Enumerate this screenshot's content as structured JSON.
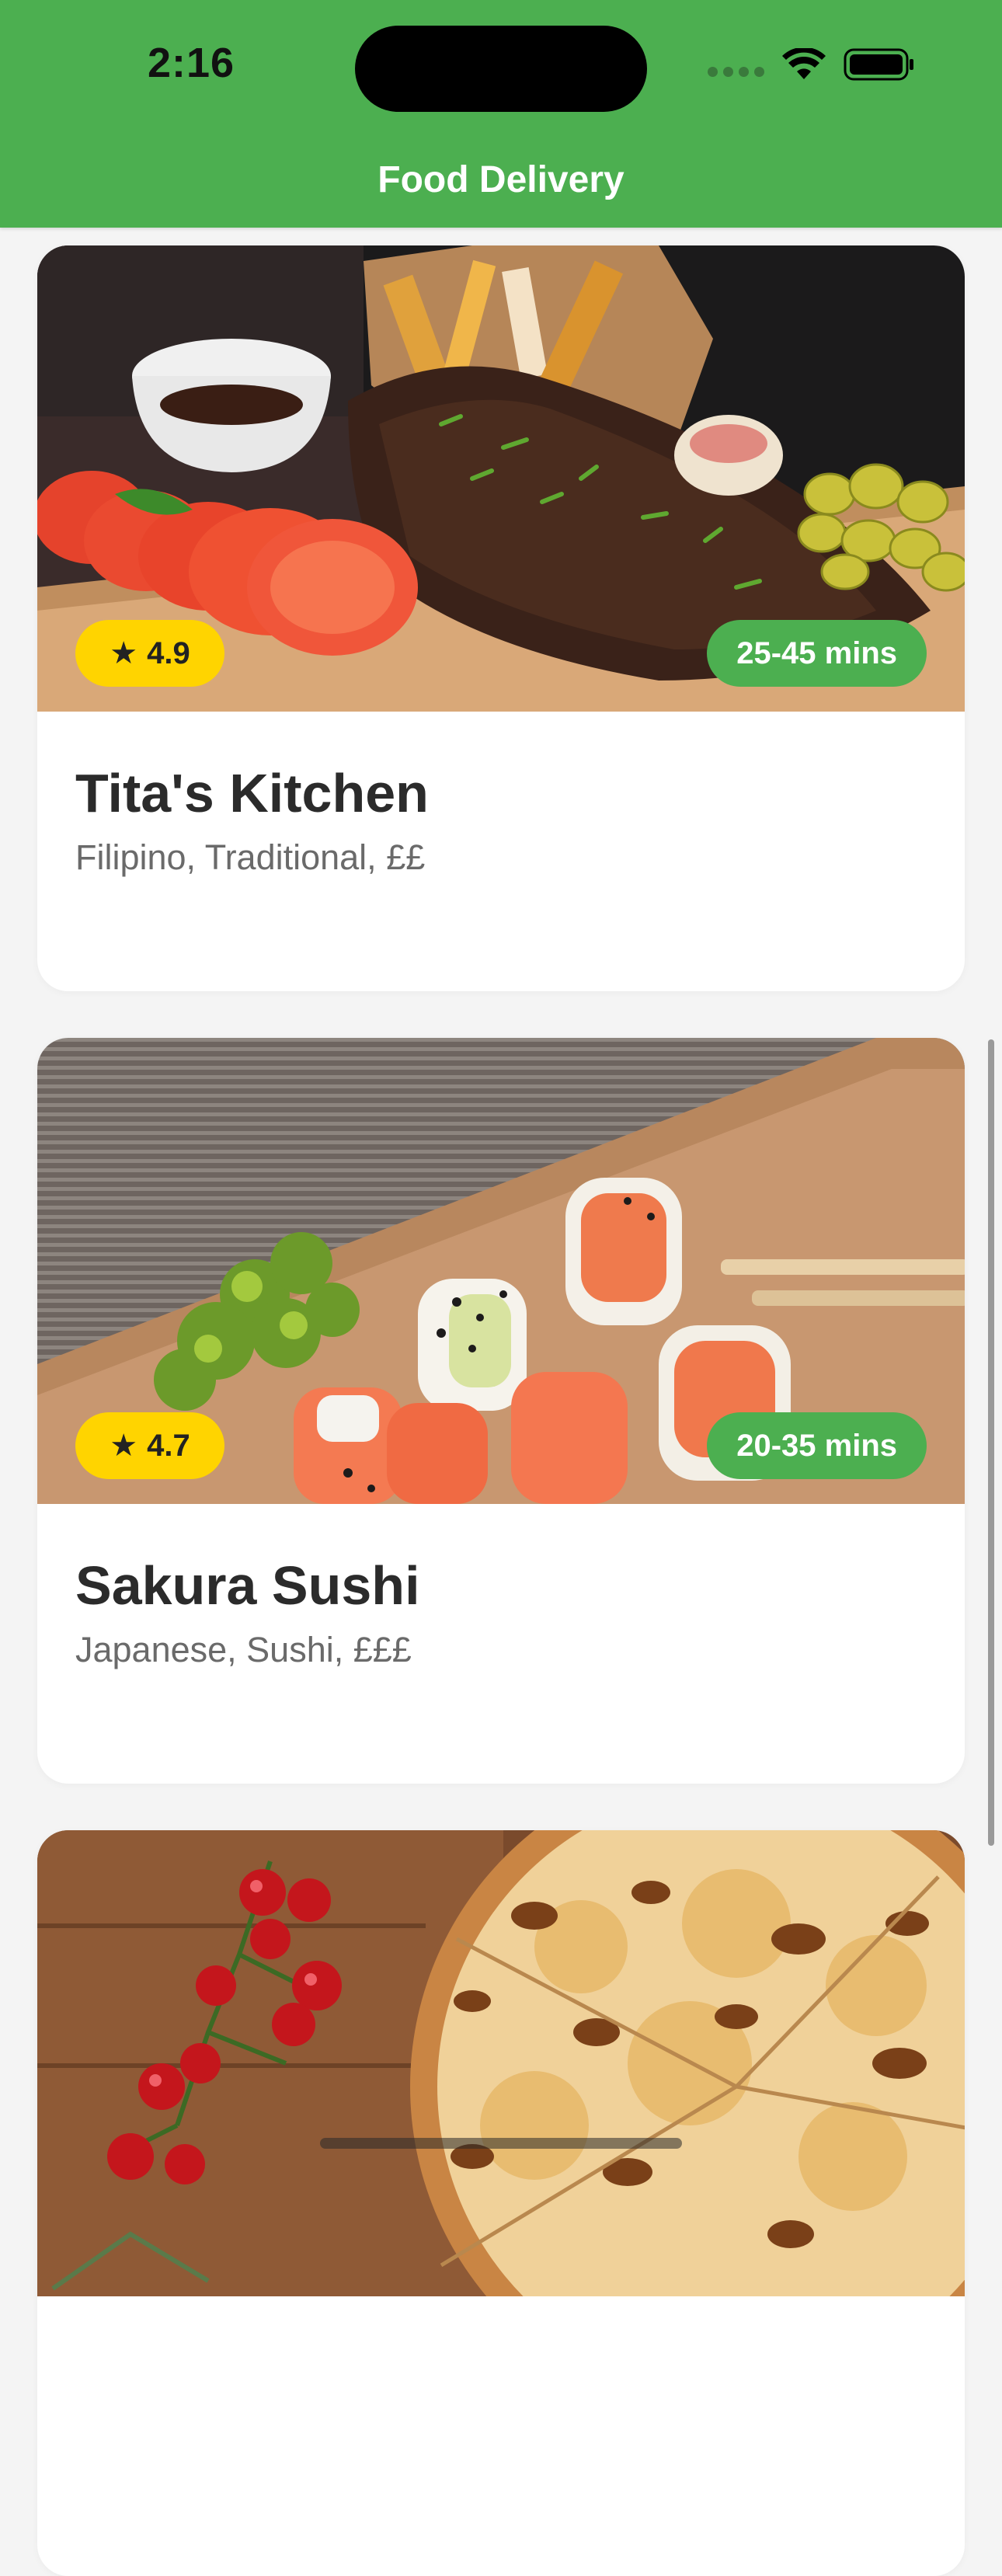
{
  "status_bar": {
    "time": "2:16"
  },
  "header": {
    "title": "Food Delivery"
  },
  "restaurants": [
    {
      "name": "Tita's Kitchen",
      "meta": "Filipino, Traditional, ££",
      "rating": "4.9",
      "eta": "25-45 mins"
    },
    {
      "name": "Sakura Sushi",
      "meta": "Japanese, Sushi, £££",
      "rating": "4.7",
      "eta": "20-35 mins"
    },
    {
      "name": "",
      "meta": "",
      "rating": "",
      "eta": ""
    }
  ],
  "colors": {
    "brand": "#4caf50",
    "rating_badge": "#ffd400",
    "text_primary": "#2b2b2b",
    "text_secondary": "#6a6a6a"
  }
}
